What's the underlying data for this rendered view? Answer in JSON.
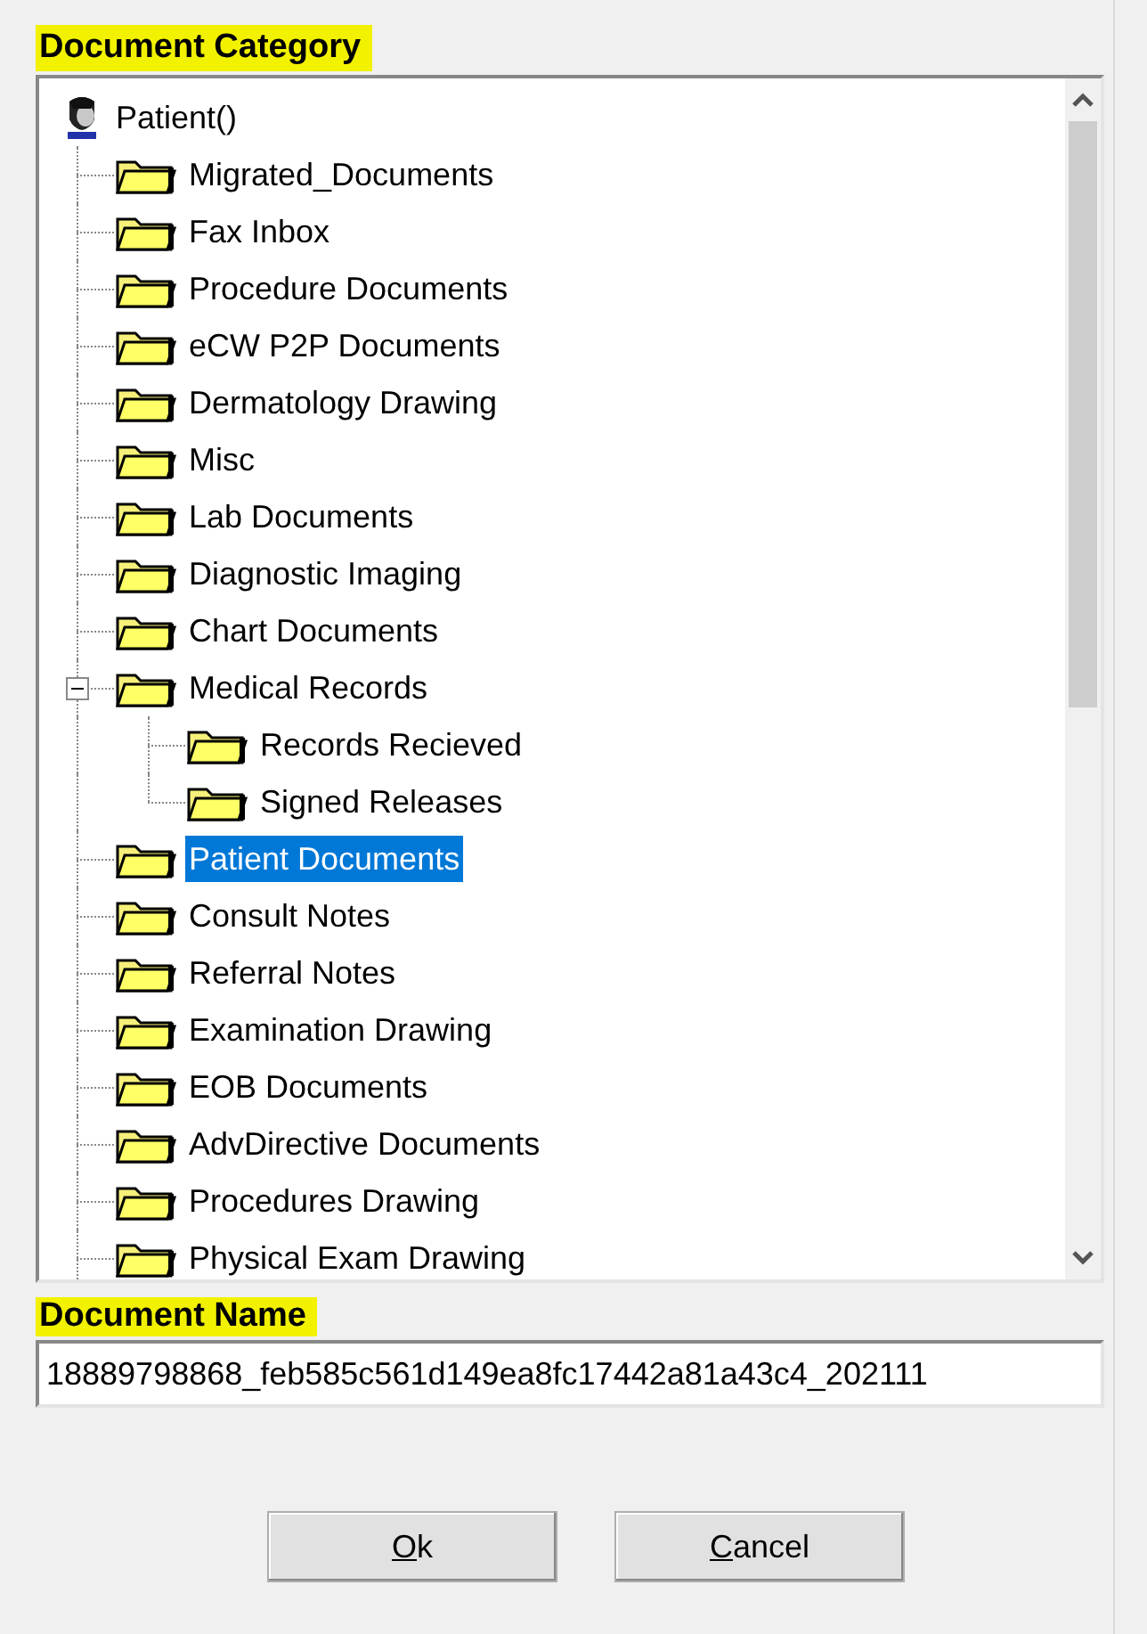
{
  "category_label": "Document Category",
  "tree": {
    "label": "Patient()",
    "children": [
      {
        "label": "Migrated_Documents",
        "selected": false
      },
      {
        "label": "Fax Inbox",
        "selected": false
      },
      {
        "label": "Procedure Documents",
        "selected": false
      },
      {
        "label": "eCW P2P Documents",
        "selected": false
      },
      {
        "label": "Dermatology Drawing",
        "selected": false
      },
      {
        "label": "Misc",
        "selected": false
      },
      {
        "label": "Lab Documents",
        "selected": false
      },
      {
        "label": "Diagnostic Imaging",
        "selected": false
      },
      {
        "label": "Chart Documents",
        "selected": false
      },
      {
        "label": "Medical Records",
        "selected": false,
        "expanded": true,
        "children": [
          {
            "label": "Records Recieved",
            "selected": false
          },
          {
            "label": "Signed Releases",
            "selected": false
          }
        ]
      },
      {
        "label": "Patient Documents",
        "selected": true
      },
      {
        "label": "Consult Notes",
        "selected": false
      },
      {
        "label": "Referral Notes",
        "selected": false
      },
      {
        "label": "Examination Drawing",
        "selected": false
      },
      {
        "label": "EOB Documents",
        "selected": false
      },
      {
        "label": "AdvDirective Documents",
        "selected": false
      },
      {
        "label": "Procedures Drawing",
        "selected": false
      },
      {
        "label": "Physical Exam Drawing",
        "selected": false
      }
    ]
  },
  "name_label": "Document Name",
  "document_name": "18889798868_feb585c561d149ea8fc17442a81a43c4_202111",
  "buttons": [
    {
      "mnemonic": "O",
      "rest": "k"
    },
    {
      "mnemonic": "C",
      "rest": "ancel"
    }
  ]
}
